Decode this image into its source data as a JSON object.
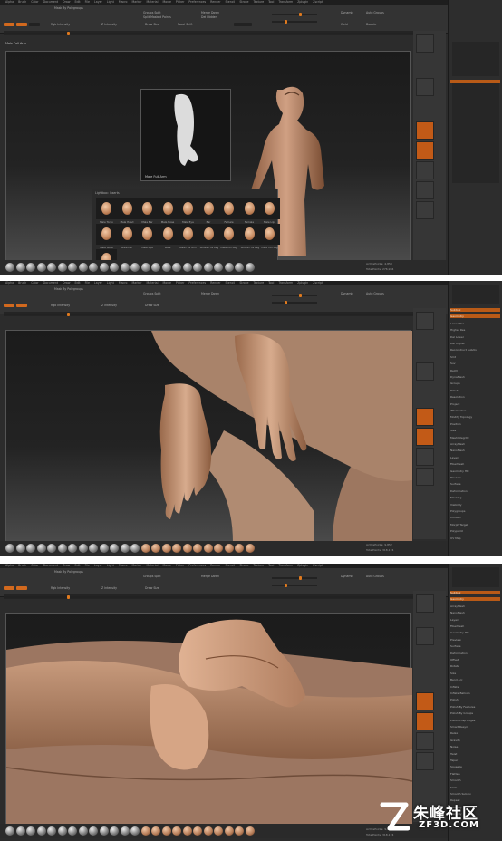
{
  "menus": [
    "Alpha",
    "Brush",
    "Color",
    "Document",
    "Draw",
    "Edit",
    "File",
    "Layer",
    "Light",
    "Macro",
    "Marker",
    "Material",
    "Movie",
    "Picker",
    "Preferences",
    "Render",
    "Stencil",
    "Stroke",
    "Texture",
    "Tool",
    "Transform",
    "Zplugin",
    "Zscript"
  ],
  "panel1": {
    "viewport_title": "Male Full Arm",
    "popup_caption": "Male Full Arm",
    "palette_title": "Lightbox: Inserts",
    "tiles": [
      "Male Torso",
      "Male Head",
      "Male Ear",
      "Male Nose",
      "Male Eye",
      "Ear",
      "Female",
      "Female",
      "Male Lips",
      "Male Nose",
      "Male Ear",
      "Male Eye",
      "Male",
      "Male Full Arm",
      "Female Full Leg",
      "Male Full Leg",
      "Female Full Leg",
      "Male Full Leg",
      "Male Full Arm"
    ],
    "stats": [
      "ActivePoints: 4,853",
      "TotalPoints: 276,904"
    ]
  },
  "panel2": {
    "stats": [
      "ActivePoints: 9,852",
      "TotalPoints: 318,174"
    ],
    "subpanel": [
      "Subtool",
      "Geometry",
      "Lower Res",
      "Higher Res",
      "Del Lower",
      "Del Higher",
      "Reconstruct Subdiv",
      "Smt",
      "Suv",
      "ReUV",
      "DynaMesh",
      "Groups",
      "Polish",
      "Resolution",
      "Project",
      "ZRemesher",
      "Modify Topology",
      "Position",
      "Size",
      "MeshIntegrity",
      "ArrayMesh",
      "NanoMesh",
      "Layers",
      "FiberMesh",
      "Geometry HD",
      "Preview",
      "Surface",
      "Deformation",
      "Masking",
      "Visibility",
      "Polygroups",
      "Contact",
      "Morph Target",
      "Polypaint",
      "UV Map"
    ]
  },
  "panel3": {
    "stats": [
      "ActivePoints: 9,852",
      "TotalPoints: 318,174"
    ],
    "subpanel": [
      "Subtool",
      "Geometry",
      "ArrayMesh",
      "NanoMesh",
      "Layers",
      "FiberMesh",
      "Geometry HD",
      "Preview",
      "Surface",
      "Deformation",
      "Offset",
      "Rotate",
      "Size",
      "Bend Arc",
      "Inflate",
      "Inflate Balloon",
      "Polish",
      "Polish By Features",
      "Polish By Groups",
      "Polish Crisp Edges",
      "Smart Resym",
      "Relax",
      "Gravity",
      "Noise",
      "Twist",
      "Taper",
      "Squeeze",
      "Flatten",
      "Smooth",
      "Slide",
      "Smooth Subdiv",
      "Repeat",
      "Masking",
      "Visibility"
    ]
  },
  "shelf": {
    "labels": [
      "Mask By Polygroups",
      "Rgb Intensity",
      "Z Intensity",
      "Draw Size",
      "Focal Shift",
      "Groups Split",
      "Split Hidden",
      "Split Masked Points",
      "Merge Down",
      "Del Hidden",
      "Mrgb",
      "Rgb",
      "M",
      "Zadd",
      "Zsub",
      "Zcut",
      "Backface",
      "Dynamic",
      "Auto Groups",
      "Mirror",
      "Weld",
      "Double"
    ],
    "values": [
      "100",
      "100",
      "64",
      "0"
    ]
  },
  "watermark": {
    "main": "朱峰社区",
    "sub": "ZF3D.COM"
  },
  "colors": {
    "accent": "#c25a17",
    "skin": "#c89271",
    "ui_dark": "#2c2c2c"
  }
}
